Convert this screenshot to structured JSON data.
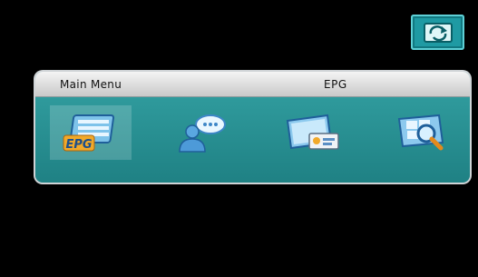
{
  "top_button": {
    "icon": "rotate-screen-icon"
  },
  "menu": {
    "title": "Main Menu",
    "selected_label": "EPG",
    "items": [
      {
        "icon": "epg-icon",
        "text": "EPG",
        "selected": true
      },
      {
        "icon": "chat-user-icon",
        "selected": false
      },
      {
        "icon": "monitor-card-icon",
        "selected": false
      },
      {
        "icon": "search-monitor-icon",
        "selected": false
      }
    ]
  },
  "colors": {
    "panel": "#2a8f92",
    "header": "#d9d9d9",
    "button": "#1f9aa3",
    "background": "#000000"
  }
}
